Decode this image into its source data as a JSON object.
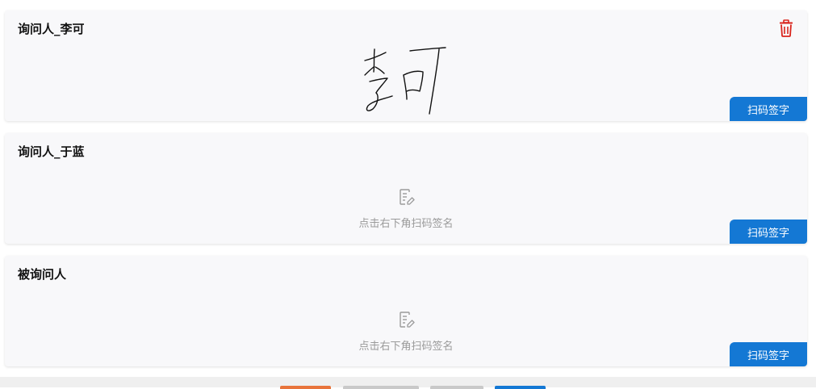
{
  "cards": [
    {
      "title": "询问人_李可",
      "signed": true,
      "scan_label": "扫码签字"
    },
    {
      "title": "询问人_于蓝",
      "signed": false,
      "placeholder": "点击右下角扫码签名",
      "scan_label": "扫码签字"
    },
    {
      "title": "被询问人",
      "signed": false,
      "placeholder": "点击右下角扫码签名",
      "scan_label": "扫码签字"
    }
  ],
  "icons": {
    "delete": "trash-icon",
    "placeholder": "edit-document-icon"
  },
  "colors": {
    "primary": "#1478d4",
    "danger": "#d9241c",
    "card_bg": "#f8f8fa",
    "placeholder_text": "#9a9a9a",
    "footer_bg": "#efefef"
  }
}
